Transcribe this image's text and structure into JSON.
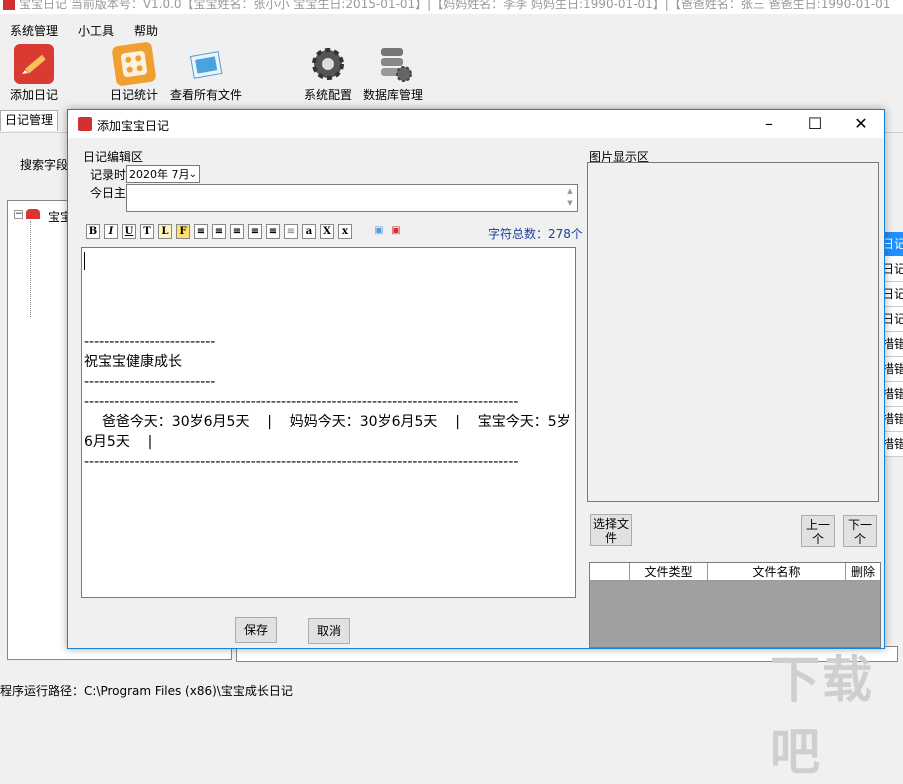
{
  "app": {
    "title_bar_text": "宝宝日记  当前版本号：V1.0.0【宝宝姓名：张小小  宝宝生日:2015-01-01】|【妈妈姓名：李李  妈妈生日:1990-01-01】|【爸爸姓名：张三  爸爸生日:1990-01-01"
  },
  "menu": {
    "items": [
      "系统管理",
      "小工具",
      "帮助"
    ]
  },
  "toolbar": {
    "add_diary": "添加日记",
    "diary_stats": "日记统计",
    "view_files": "查看所有文件",
    "sys_config": "系统配置",
    "db_manage": "数据库管理"
  },
  "tabs": {
    "diary_manage": "日记管理"
  },
  "search": {
    "label": "搜索字段"
  },
  "tree": {
    "root_label": "宝宝"
  },
  "grid_partial": [
    "日记",
    "日记",
    "日记",
    "日记",
    "措错",
    "措错",
    "措错",
    "措错",
    "措错"
  ],
  "status": {
    "path_text": "程序运行路径：C:\\Program Files (x86)\\宝宝成长日记"
  },
  "watermark": "下载吧",
  "dialog": {
    "title": "添加宝宝日记",
    "edit_group": "日记编辑区",
    "record_time_label": "记录时",
    "record_time_value": "2020年 7月",
    "subject_label": "今日主",
    "subject_value": "",
    "char_count": "字符总数：278个",
    "editor_text": "\n\n\n\n--------------------------\n祝宝宝健康成长\n--------------------------\n--------------------------------------------------------------------------------------\n    爸爸今天：30岁6月5天    |    妈妈今天：30岁6月5天    |    宝宝今天：5岁6月5天    |\n--------------------------------------------------------------------------------------",
    "save_button": "保存",
    "cancel_button": "取消",
    "image_group": "图片显示区",
    "choose_file": "选择文件",
    "prev": "上一个",
    "next": "下一个",
    "table_headers": [
      "文件类型",
      "文件名称",
      "删除"
    ],
    "format_buttons": [
      "B",
      "I",
      "U",
      "T",
      "L",
      "F",
      "≡",
      "≡",
      "≡",
      "≡",
      "≡",
      "≡",
      "a",
      "X",
      "x",
      "▣",
      "▣"
    ]
  },
  "colors": {
    "accent": "#1883d7",
    "grid_selected": "#1e90ff",
    "brand_red": "#d32f2f"
  }
}
